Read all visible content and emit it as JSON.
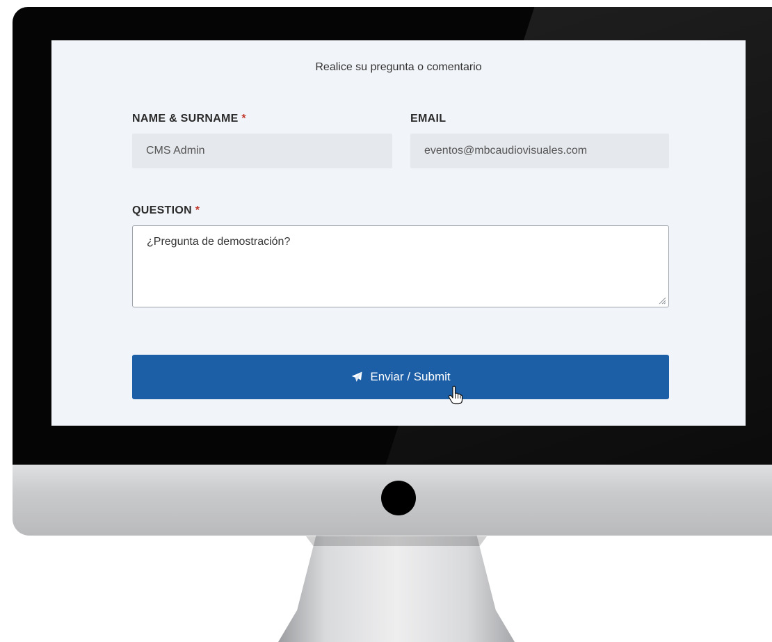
{
  "form": {
    "title": "Realice su pregunta o comentario",
    "name_label": "NAME & SURNAME",
    "name_required": "*",
    "name_value": "CMS Admin",
    "email_label": "EMAIL",
    "email_value": "eventos@mbcaudiovisuales.com",
    "question_label": "QUESTION",
    "question_required": "*",
    "question_value": "¿Pregunta de demostración?",
    "submit_label": "Enviar / Submit",
    "submit_icon": "paper-plane-icon"
  },
  "colors": {
    "button": "#1c5fa6",
    "required": "#c0392b",
    "screen_bg": "#f1f4f8",
    "input_bg": "#e5e8ec"
  }
}
